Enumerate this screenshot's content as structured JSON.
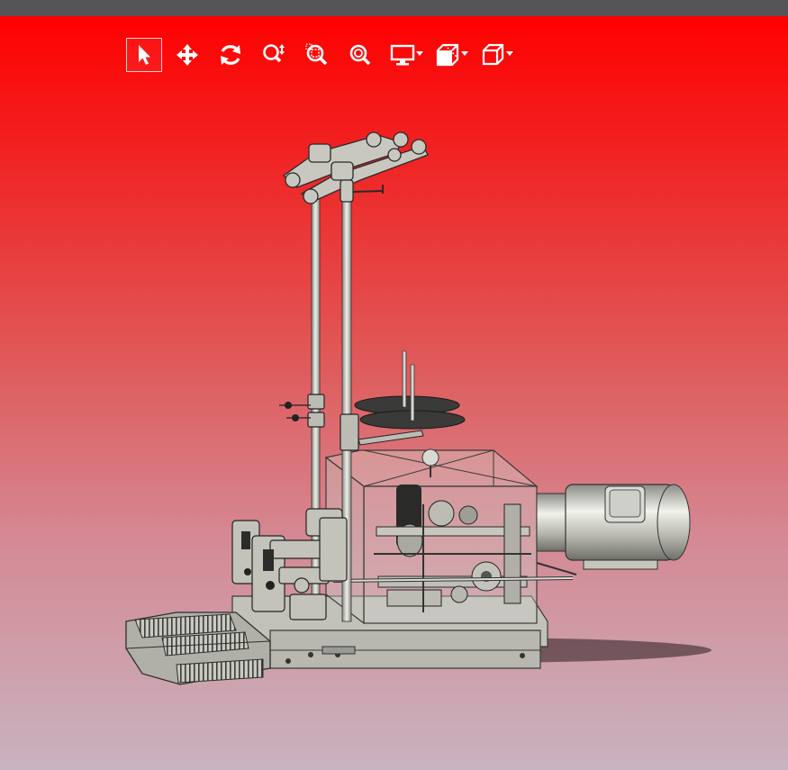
{
  "window": {
    "title_bar_color": "#555558"
  },
  "viewport": {
    "background_top": "#ff0000",
    "background_bottom": "#c8b3bf",
    "model_color": "#bdbcb4"
  },
  "toolbar": {
    "tools": [
      {
        "name": "select",
        "icon": "arrow-pointer-icon",
        "active": true
      },
      {
        "name": "pan",
        "icon": "move-arrows-icon",
        "active": false
      },
      {
        "name": "rotate",
        "icon": "rotate-icon",
        "active": false
      },
      {
        "name": "zoom",
        "icon": "zoom-updown-icon",
        "active": false
      },
      {
        "name": "zoom-window",
        "icon": "zoom-window-icon",
        "active": false
      },
      {
        "name": "zoom-fit",
        "icon": "zoom-fit-icon",
        "active": false
      },
      {
        "name": "display-mode",
        "icon": "monitor-icon",
        "has_dropdown": true
      },
      {
        "name": "section-view",
        "icon": "section-box-icon",
        "has_dropdown": true
      },
      {
        "name": "standard-views",
        "icon": "cube-icon",
        "has_dropdown": true
      }
    ]
  }
}
